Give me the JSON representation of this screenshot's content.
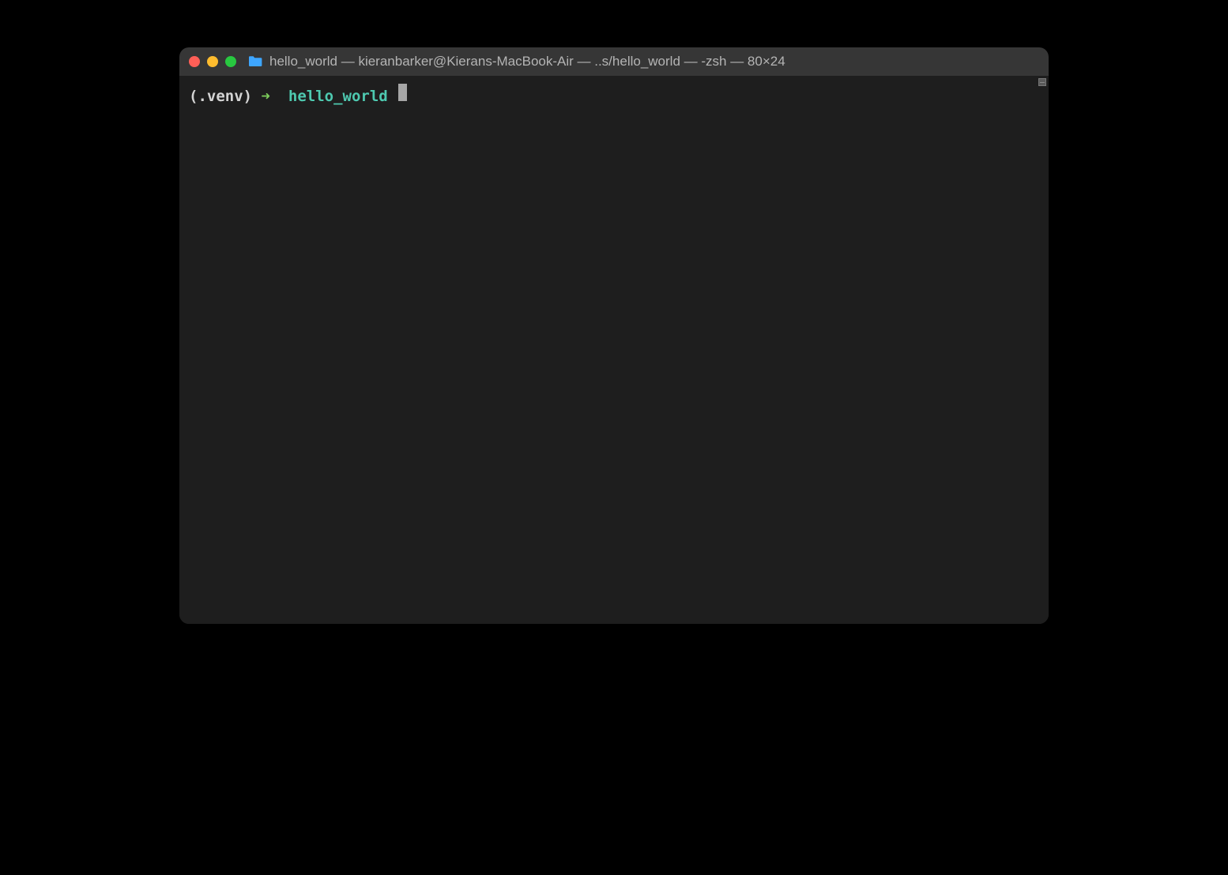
{
  "window": {
    "title": "hello_world — kieranbarker@Kierans-MacBook-Air — ..s/hello_world — -zsh — 80×24",
    "folder_icon_color": "#3ea6ff"
  },
  "traffic_lights": {
    "close_color": "#ff5f57",
    "minimize_color": "#febc2e",
    "maximize_color": "#28c840"
  },
  "prompt": {
    "venv": "(.venv)",
    "arrow": "➜",
    "cwd": "hello_world"
  },
  "colors": {
    "background": "#1e1e1e",
    "title_bar": "#363636",
    "prompt_arrow": "#7dce5c",
    "prompt_cwd": "#4ec9b0",
    "text": "#d4d4d4"
  }
}
